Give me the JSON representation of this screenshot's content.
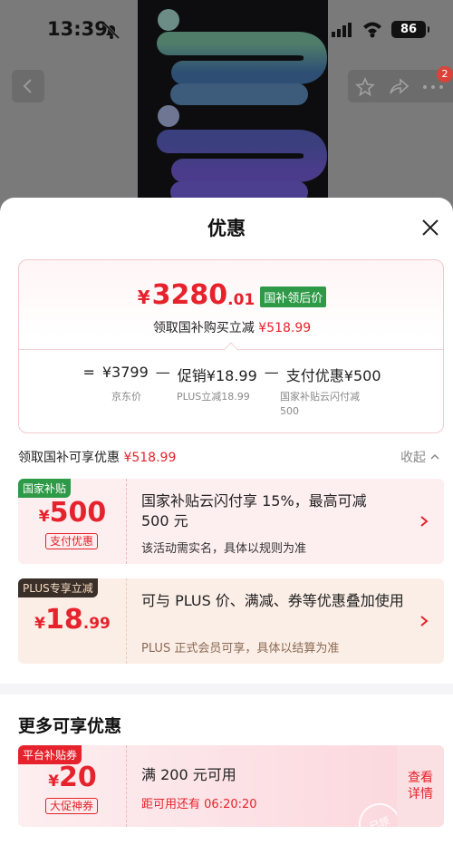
{
  "status_bar": {
    "time": "13:39",
    "battery": "86"
  },
  "nav": {
    "badge": "2"
  },
  "sheet": {
    "title": "优惠",
    "price_card": {
      "currency": "¥",
      "price_int": "3280",
      "price_dec": ".01",
      "tag": "国补领后价",
      "subtitle_prefix": "领取国补购买立减",
      "subtitle_amount": "¥518.99",
      "calc": {
        "eq": "=",
        "original": "¥3799",
        "minus1": "—",
        "promo": "促销¥18.99",
        "minus2": "—",
        "pay_discount": "支付优惠¥500"
      },
      "calc_labels": {
        "original": "京东价",
        "promo": "PLUS立减18.99",
        "pay_line1": "国家补贴云闪付减",
        "pay_line2": "500"
      }
    },
    "available": {
      "label": "领取国补可享优惠",
      "amount": "¥518.99",
      "collapse": "收起"
    },
    "coupons": [
      {
        "tag": "国家补贴",
        "tag_color": "#2e9a48",
        "currency": "¥",
        "amount": "500",
        "decimal": "",
        "sub": "支付优惠",
        "title": "国家补贴云闪付享 15%，最高可减 500 元",
        "note": "该活动需实名，具体以规则为准"
      },
      {
        "tag": "PLUS专享立减",
        "tag_color": "#3b2f2a",
        "currency": "¥",
        "amount": "18",
        "decimal": ".99",
        "title": "可与 PLUS 价、满减、券等优惠叠加使用",
        "note": "PLUS 正式会员可享，具体以结算为准"
      }
    ],
    "more": {
      "title": "更多可享优惠",
      "coupon": {
        "tag": "平台补贴券",
        "tag_color": "#e6232c",
        "currency": "¥",
        "amount": "20",
        "sub": "大促神券",
        "title": "满 200 元可用",
        "note_prefix": "距可用还有",
        "countdown": "06:20:20",
        "detail_line1": "查看",
        "detail_line2": "详情",
        "stamp": "已领"
      }
    }
  },
  "colors": {
    "accent_red": "#e6232c",
    "green_tag": "#2e9a48",
    "plus_tag": "#3b2f2a"
  }
}
